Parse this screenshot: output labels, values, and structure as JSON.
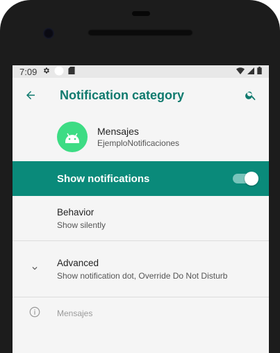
{
  "status_bar": {
    "time": "7:09",
    "icons_left": [
      "settings-icon",
      "circle-icon",
      "sdcard-icon"
    ],
    "icons_right": [
      "wifi-icon",
      "signal-icon",
      "battery-icon"
    ]
  },
  "app_bar": {
    "title": "Notification category",
    "back_icon": "arrow-back-icon",
    "search_icon": "search-icon"
  },
  "app_header": {
    "name": "Mensajes",
    "package": "EjemploNotificaciones",
    "icon": "android-icon"
  },
  "show_notifications": {
    "label": "Show notifications",
    "enabled": true
  },
  "behavior": {
    "title": "Behavior",
    "summary": "Show silently"
  },
  "advanced": {
    "title": "Advanced",
    "summary": "Show notification dot, Override Do Not Disturb",
    "icon": "chevron-down-icon"
  },
  "footer": {
    "text": "Mensajes",
    "icon": "info-icon"
  },
  "colors": {
    "accent": "#0a8a7a",
    "title_text": "#0f7a6e",
    "app_icon_bg": "#3ddc84"
  }
}
